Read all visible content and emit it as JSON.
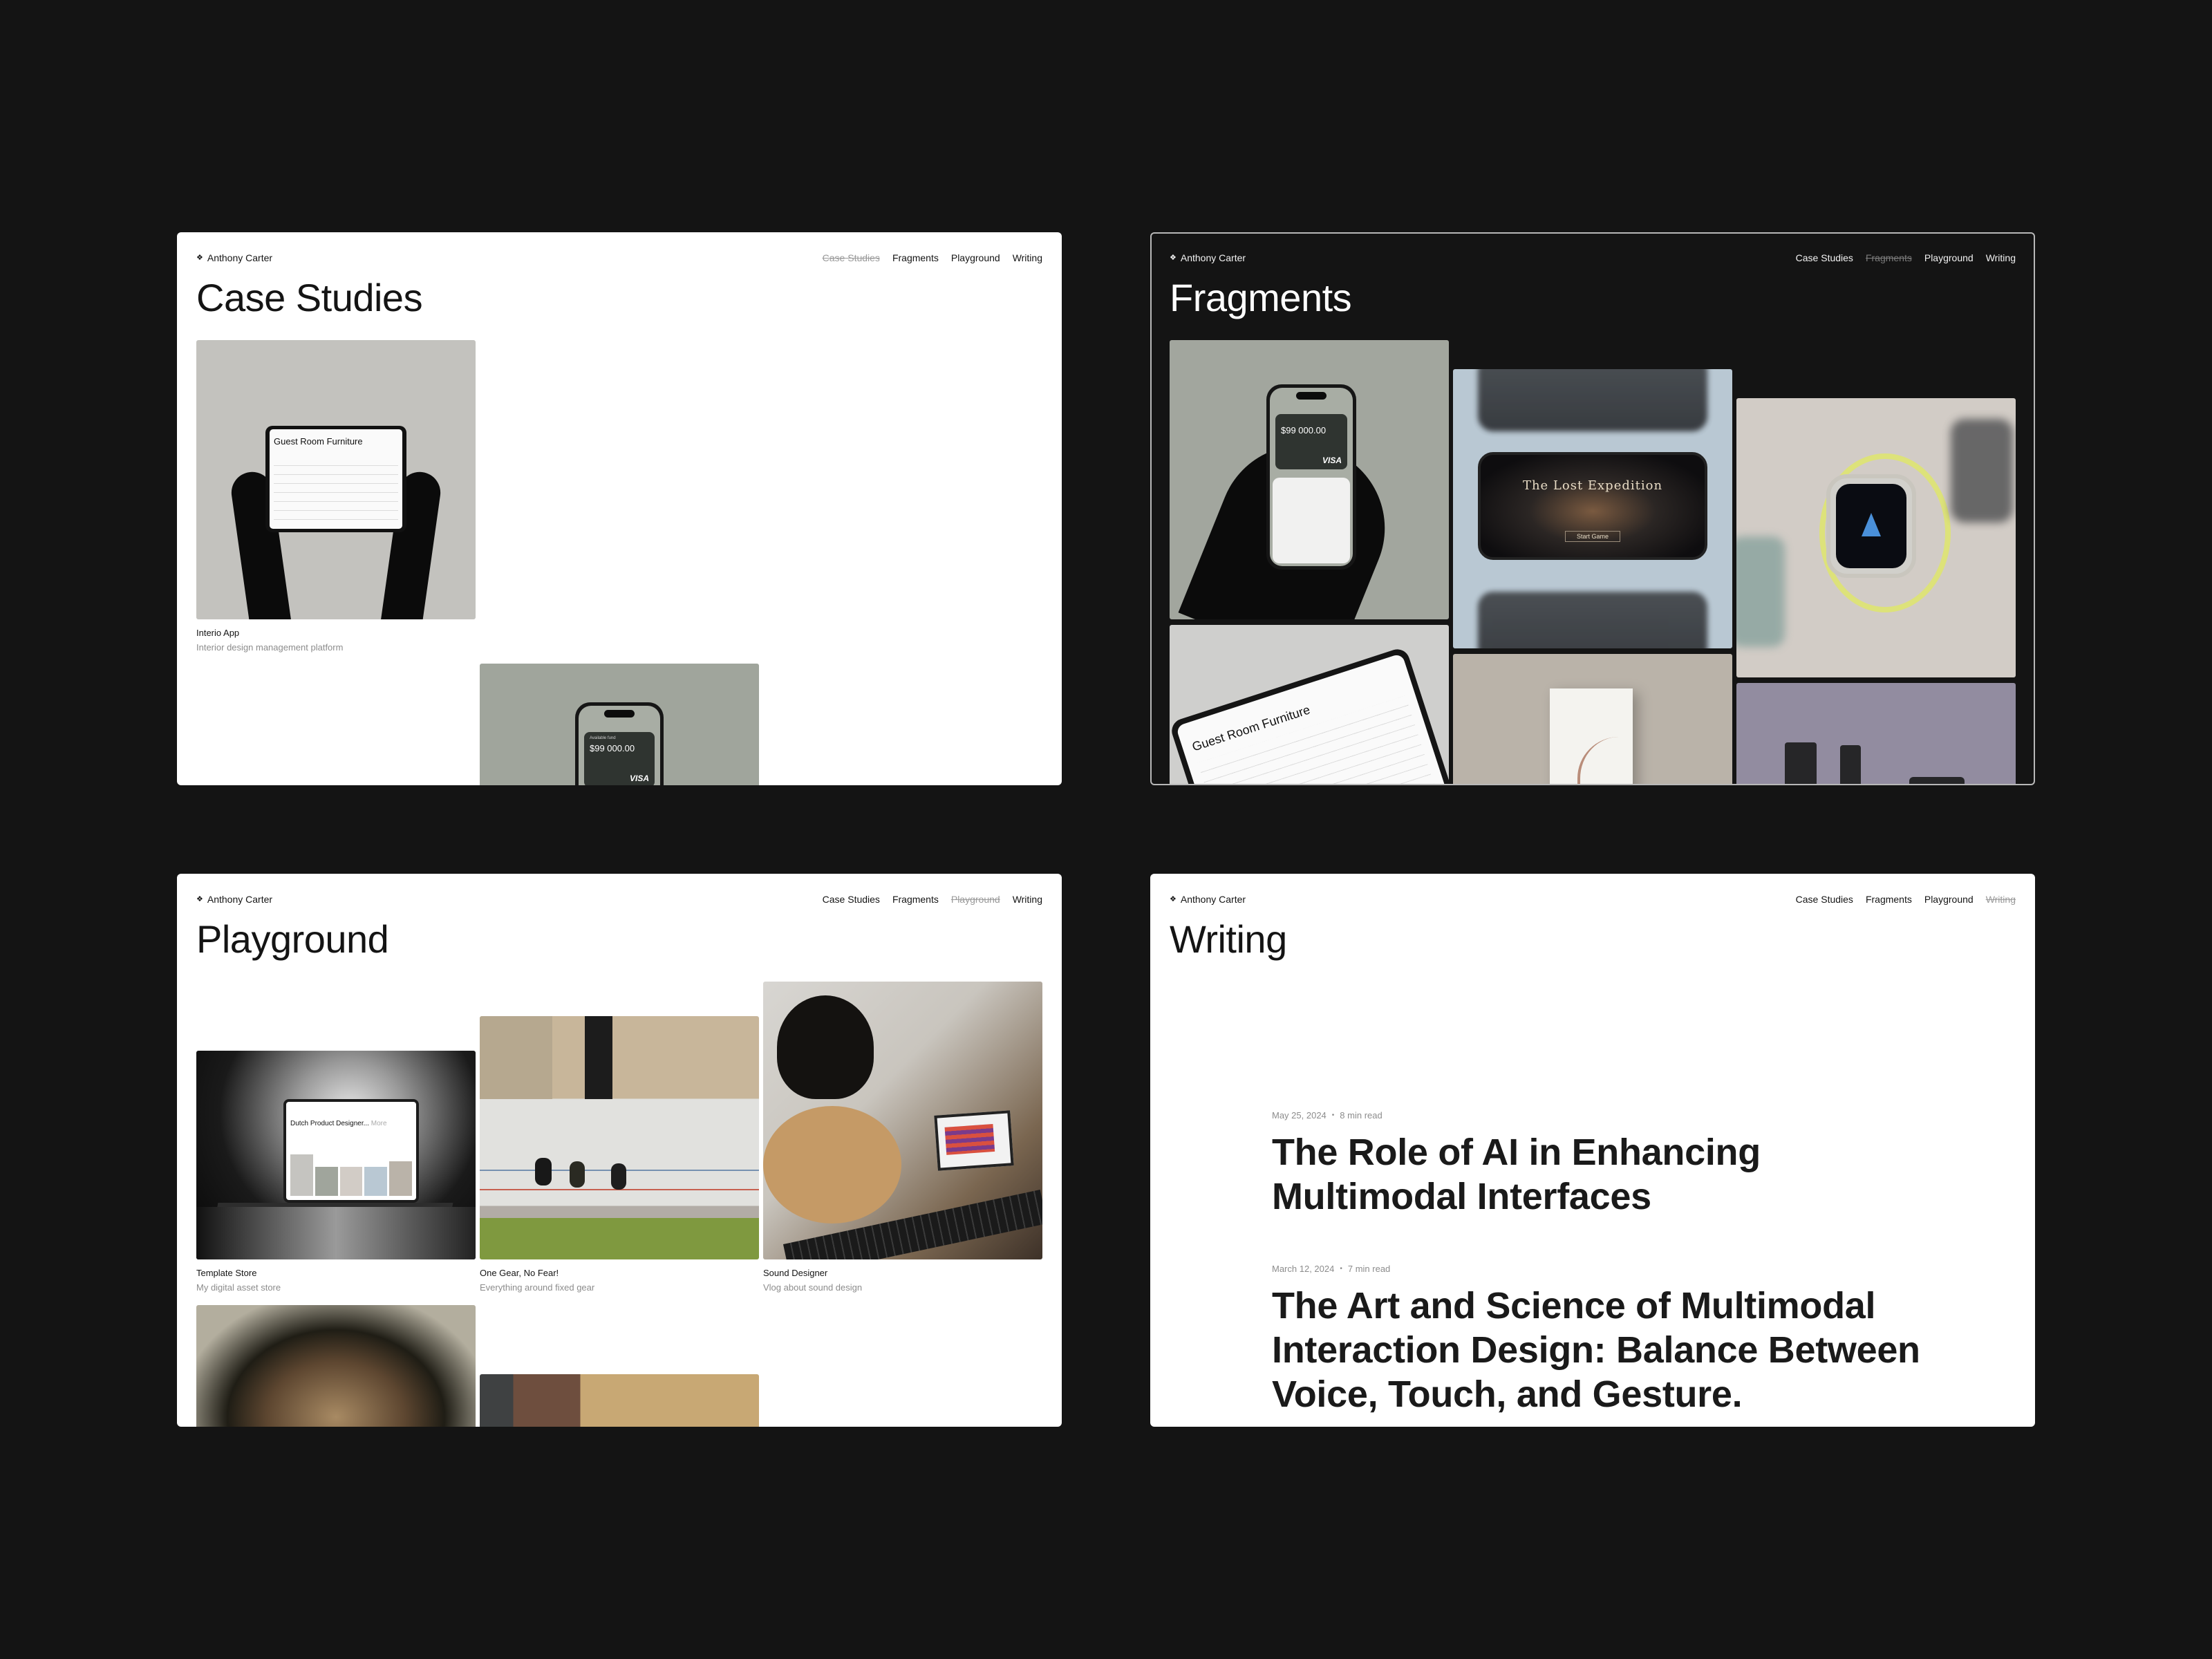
{
  "canvas_background": "#141414",
  "site": {
    "brand": "Anthony Carter",
    "logo_icon": "four-petal-flower-icon",
    "nav": [
      "Case Studies",
      "Fragments",
      "Playground",
      "Writing"
    ]
  },
  "panels": {
    "case_studies": {
      "theme": "light",
      "active_nav": "Case Studies",
      "title": "Case Studies",
      "cards": [
        {
          "title": "Interio App",
          "subtitle": "Interior design management platform",
          "image": "hands-holding-tablet",
          "screen_title": "Guest Room Furniture"
        },
        {
          "image": "phone-wallet-app",
          "screen_label": "Available fund",
          "screen_amount": "$99 000.00",
          "screen_brand": "VISA"
        }
      ]
    },
    "fragments": {
      "theme": "dark",
      "active_nav": "Fragments",
      "title": "Fragments",
      "tiles": [
        {
          "image": "hand-holding-phone-wallet",
          "amount": "$99 000.00",
          "brand": "VISA"
        },
        {
          "image": "tablet-guest-room-furniture",
          "screen_title": "Guest Room Furniture"
        },
        {
          "image": "phone-game-lost-expedition",
          "game_title": "The Lost Expedition",
          "game_button": "Start Game"
        },
        {
          "image": "book-cover"
        },
        {
          "image": "smartwatch-yellow-band"
        },
        {
          "image": "cosmetic-bottles"
        }
      ]
    },
    "playground": {
      "theme": "light",
      "active_nav": "Playground",
      "title": "Playground",
      "cards": [
        {
          "title": "Template Store",
          "subtitle": "My digital asset store",
          "image": "laptop-on-ledge",
          "screen_title": "Dutch Product Designer...",
          "screen_more": "More"
        },
        {
          "title": "One Gear, No Fear!",
          "subtitle": "Everything around fixed gear",
          "image": "track-cyclists"
        },
        {
          "title": "Sound Designer",
          "subtitle": "Vlog about sound design",
          "image": "guitarist-with-laptop"
        },
        {
          "image": "portrait"
        },
        {
          "image": "abstract-painting"
        }
      ]
    },
    "writing": {
      "theme": "light",
      "active_nav": "Writing",
      "title": "Writing",
      "posts": [
        {
          "date": "May 25, 2024",
          "read_time": "8 min read",
          "title": "The Role of AI in Enhancing Multimodal Interfaces"
        },
        {
          "date": "March 12, 2024",
          "read_time": "7 min read",
          "title": "The Art and Science of Multimodal Interaction Design: Balance Between Voice, Touch, and Gesture."
        }
      ]
    }
  }
}
